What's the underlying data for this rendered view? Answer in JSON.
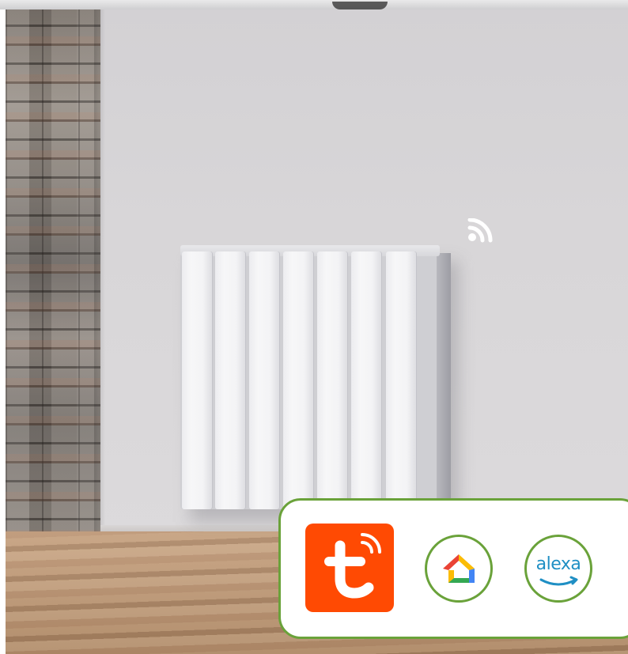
{
  "scene": {
    "icons": {
      "wifi": "wifi-signal-icon",
      "tuya": "tuya-smart-logo",
      "google_home": "google-home-logo",
      "alexa": "amazon-alexa-logo"
    },
    "logos": {
      "alexa_text": "alexa"
    },
    "colors": {
      "panel_border": "#6aa23a",
      "tuya_orange": "#ff4a03",
      "alexa_blue": "#1f8fc4",
      "google_blue": "#4285f4",
      "google_red": "#ea4335",
      "google_yellow": "#fbbc05",
      "google_green": "#34a853"
    }
  }
}
